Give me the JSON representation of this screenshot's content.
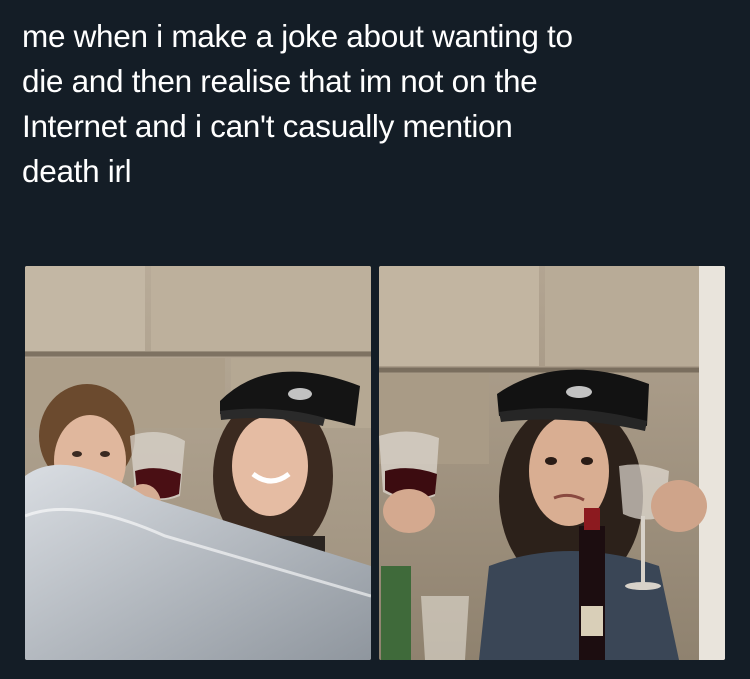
{
  "tweet": {
    "text": "me when i make a joke about wanting to\ndie and then realise that im not on the\nInternet and i can't casually mention\ndeath irl"
  },
  "media": {
    "images": [
      {
        "name": "left-photo"
      },
      {
        "name": "right-photo"
      }
    ]
  },
  "colors": {
    "background": "#141d26",
    "text": "#ffffff"
  }
}
